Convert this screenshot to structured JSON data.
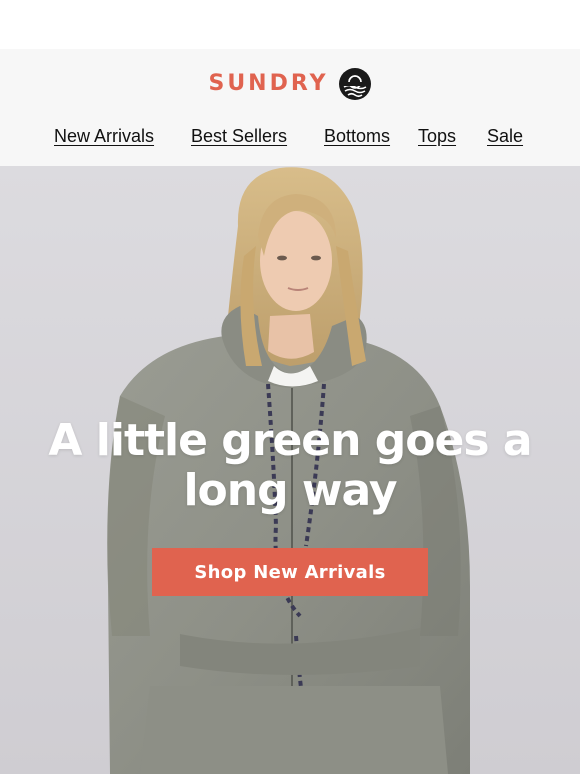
{
  "brand": {
    "name": "SUNDRY",
    "color": "#e0634f"
  },
  "nav": {
    "items": [
      {
        "label": "New Arrivals"
      },
      {
        "label": "Best Sellers"
      },
      {
        "label": "Bottoms"
      },
      {
        "label": "Tops"
      },
      {
        "label": "Sale"
      }
    ]
  },
  "hero": {
    "headline_line1": "A little green goes a",
    "headline_line2": "long way",
    "cta_label": "Shop New Arrivals",
    "cta_color": "#e0634f",
    "image_subject": "model-in-sage-green-zip-hoodie"
  }
}
